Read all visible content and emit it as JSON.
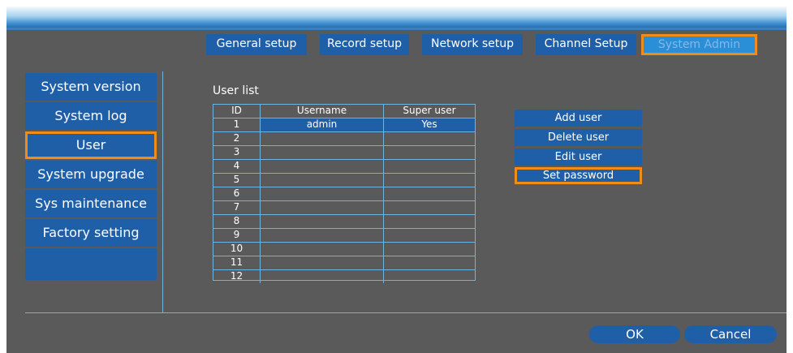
{
  "tabs": [
    {
      "label": "General setup"
    },
    {
      "label": "Record setup"
    },
    {
      "label": "Network setup"
    },
    {
      "label": "Channel Setup"
    },
    {
      "label": "System Admin"
    }
  ],
  "sidebar": {
    "items": [
      {
        "label": "System version"
      },
      {
        "label": "System log"
      },
      {
        "label": "User"
      },
      {
        "label": "System upgrade"
      },
      {
        "label": "Sys maintenance"
      },
      {
        "label": "Factory setting"
      },
      {
        "label": ""
      }
    ]
  },
  "user_list": {
    "title": "User list",
    "columns": [
      "ID",
      "Username",
      "Super user"
    ],
    "rows": [
      [
        "1",
        "admin",
        "Yes"
      ],
      [
        "2",
        "",
        ""
      ],
      [
        "3",
        "",
        ""
      ],
      [
        "4",
        "",
        ""
      ],
      [
        "5",
        "",
        ""
      ],
      [
        "6",
        "",
        ""
      ],
      [
        "7",
        "",
        ""
      ],
      [
        "8",
        "",
        ""
      ],
      [
        "9",
        "",
        ""
      ],
      [
        "10",
        "",
        ""
      ],
      [
        "11",
        "",
        ""
      ],
      [
        "12",
        "",
        ""
      ]
    ]
  },
  "actions": {
    "add_user": "Add user",
    "delete_user": "Delete user",
    "edit_user": "Edit user",
    "set_password": "Set password"
  },
  "footer": {
    "ok": "OK",
    "cancel": "Cancel"
  },
  "colors": {
    "accent": "#f08c1a",
    "button_blue": "#1f5fa8",
    "active_tab_blue": "#2b8fd8",
    "background": "#5a5a5a"
  }
}
